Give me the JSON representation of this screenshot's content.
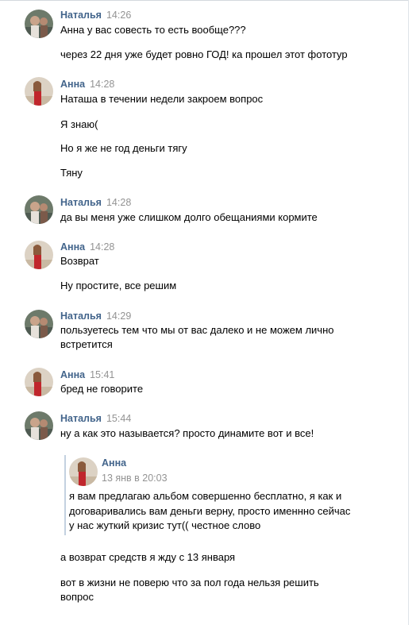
{
  "senders": {
    "natalia": "Наталья",
    "anna": "Анна"
  },
  "messages": [
    {
      "sender": "Наталья",
      "time": "14:26",
      "lines": [
        "Анна у вас совесть то есть вообще???",
        "через 22 дня уже будет ровно ГОД! ка прошел этот фототур"
      ]
    },
    {
      "sender": "Анна",
      "time": "14:28",
      "lines": [
        "Наташа в течении недели закроем вопрос",
        "Я знаю(",
        "Но я же не год деньги тягу",
        "Тяну"
      ]
    },
    {
      "sender": "Наталья",
      "time": "14:28",
      "lines": [
        "да вы меня уже слишком долго обещаниями кормите"
      ]
    },
    {
      "sender": "Анна",
      "time": "14:28",
      "lines": [
        "Возврат",
        "Ну простите, все решим"
      ]
    },
    {
      "sender": "Наталья",
      "time": "14:29",
      "lines": [
        "пользуетесь тем что мы от вас далеко и не можем лично",
        "встретится"
      ]
    },
    {
      "sender": "Анна",
      "time": "15:41",
      "lines": [
        "бред не говорите"
      ]
    },
    {
      "sender": "Наталья",
      "time": "15:44",
      "lines": [
        "ну а как это называется? просто динамите вот и все!"
      ]
    }
  ],
  "forwarded": {
    "sender": "Анна",
    "date": "13 янв в 20:03",
    "lines": [
      "я вам предлагаю альбом совершенно бесплатно, я как и",
      "договаривались вам деньги верну, просто именнно сейчас",
      "у нас жуткий кризис тут(( честное слово"
    ]
  },
  "after_lines": [
    "а возврат средств я жду с 13 января",
    "вот в жизни не поверю что за пол года нельзя решить",
    "вопрос"
  ],
  "colors": {
    "name": "#42648b",
    "time": "#939393",
    "quote_bar": "#c3d1e0",
    "divider": "#d3d9de"
  }
}
